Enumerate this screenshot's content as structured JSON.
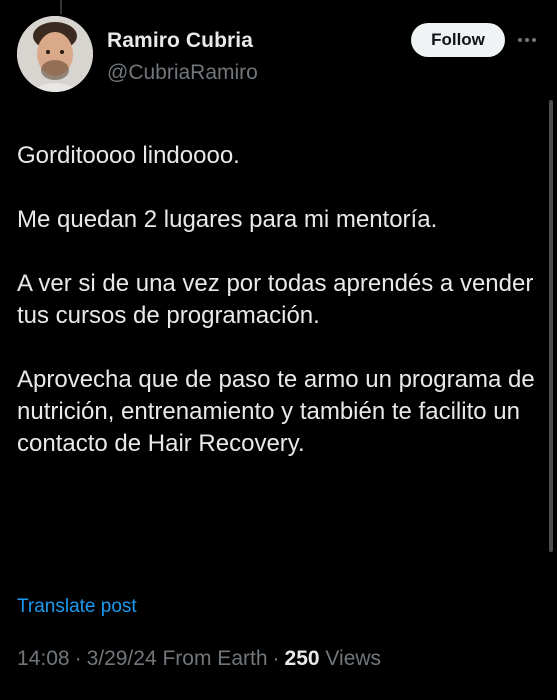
{
  "author": {
    "name": "Ramiro Cubria",
    "handle": "@CubriaRamiro"
  },
  "actions": {
    "follow_label": "Follow"
  },
  "post": {
    "paragraphs": [
      "Gorditoooo lindoooo.",
      "Me quedan 2 lugares para mi mentoría.",
      "A ver si de una vez por todas aprendés a vender tus cursos de programación.",
      "Aprovecha que de paso te armo un programa de nutrición, entrenamiento y también te facilito un contacto de Hair Recovery."
    ],
    "translate_label": "Translate post"
  },
  "meta": {
    "time": "14:08",
    "date": "3/29/24",
    "source": "From Earth",
    "views_count": "250",
    "views_label": "Views"
  },
  "colors": {
    "background": "#000000",
    "text_primary": "#e7e9ea",
    "text_secondary": "#71767b",
    "link": "#1d9bf0",
    "follow_bg": "#eff3f4"
  },
  "icons": {
    "more": "more-horizontal-icon"
  }
}
